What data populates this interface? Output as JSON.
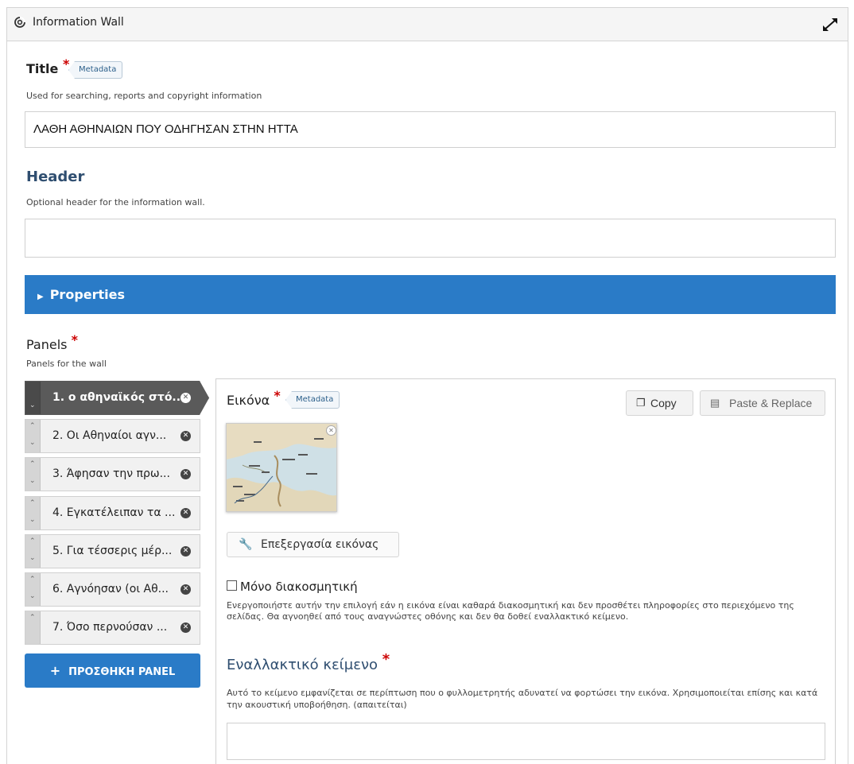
{
  "window": {
    "title": "Information Wall"
  },
  "title_field": {
    "label": "Title",
    "required_mark": "*",
    "metadata_tag": "Metadata",
    "description": "Used for searching, reports and copyright information",
    "value": "ΛΑΘΗ ΑΘΗΝΑΙΩΝ ΠΟΥ ΟΔΗΓΗΣΑΝ ΣΤΗΝ ΗΤΤΑ"
  },
  "header_field": {
    "label": "Header",
    "description": "Optional header for the information wall.",
    "value": ""
  },
  "properties": {
    "label": "Properties"
  },
  "panels": {
    "label": "Panels",
    "required_mark": "*",
    "description": "Panels for the wall",
    "items": [
      {
        "label": "1. ο αθηναϊκός στό..."
      },
      {
        "label": "2. Οι Αθηναίοι αγν..."
      },
      {
        "label": "3. Άφησαν την πρω..."
      },
      {
        "label": "4. Εγκατέλειπαν τα ..."
      },
      {
        "label": "5. Για τέσσερις μέρ..."
      },
      {
        "label": "6. Αγνόησαν (οι Αθ..."
      },
      {
        "label": "7. Όσο περνούσαν ..."
      }
    ],
    "add_button": "ΠΡΟΣΘΗΚΗ PANEL"
  },
  "image_field": {
    "label": "Εικόνα",
    "required_mark": "*",
    "metadata_tag": "Metadata",
    "copy_button": "Copy",
    "paste_button": "Paste & Replace",
    "edit_button": "Επεξεργασία εικόνας",
    "decorative_label": "Μόνο διακοσμητική",
    "decorative_description": "Ενεργοποιήστε αυτήν την επιλογή εάν η εικόνα είναι καθαρά διακοσμητική και δεν προσθέτει πληροφορίες στο περιεχόμενο της σελίδας. Θα αγνοηθεί από τους αναγνώστες οθόνης και δεν θα δοθεί εναλλακτικό κείμενο."
  },
  "alt_field": {
    "label": "Εναλλακτικό κείμενο",
    "required_mark": "*",
    "description": "Αυτό το κείμενο εμφανίζεται σε περίπτωση που ο φυλλομετρητής αδυνατεί να φορτώσει την εικόνα. Χρησιμοποιείται επίσης και κατά την ακουστική υποβοήθηση. (απαιτείται)",
    "value": ""
  },
  "colors": {
    "accent": "#2a7bc7",
    "required": "#cc0000",
    "active_tab": "#5a5a5a"
  }
}
